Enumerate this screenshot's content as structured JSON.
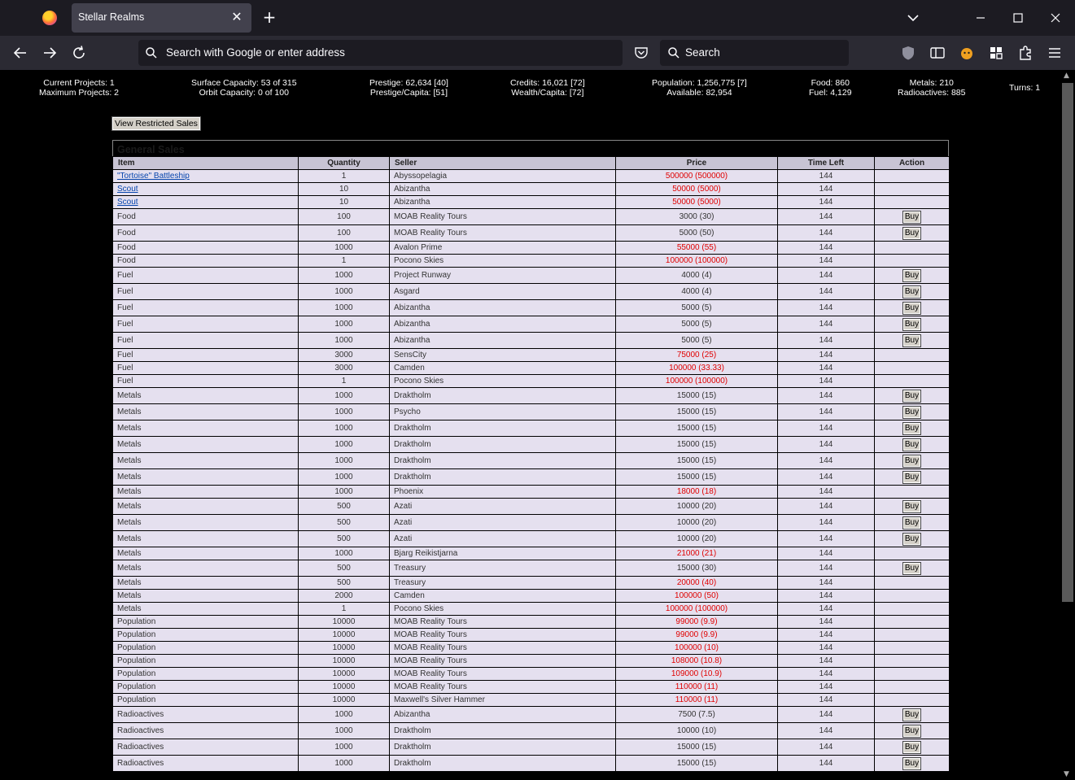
{
  "browser": {
    "tab_title": "Stellar Realms",
    "url_placeholder": "Search with Google or enter address",
    "search_placeholder": "Search"
  },
  "stats": {
    "projects_current": "Current Projects: 1",
    "projects_max": "Maximum Projects: 2",
    "surface": "Surface Capacity: 53 of 315",
    "orbit": "Orbit Capacity: 0 of 100",
    "prestige": "Prestige: 62,634 [40]",
    "prestige_capita": "Prestige/Capita: [51]",
    "credits": "Credits: 16,021 [72]",
    "wealth_capita": "Wealth/Capita: [72]",
    "population": "Population: 1,256,775 [7]",
    "available": "Available: 82,954",
    "food": "Food: 860",
    "fuel": "Fuel: 4,129",
    "metals": "Metals: 210",
    "radioactives": "Radioactives: 885",
    "turns": "Turns: 1"
  },
  "restricted_button": "View Restricted Sales",
  "sales": {
    "title": "General Sales",
    "columns": [
      "Item",
      "Quantity",
      "Seller",
      "Price",
      "Time Left",
      "Action"
    ],
    "buy_label": "Buy",
    "rows": [
      {
        "item": "\"Tortoise\" Battleship",
        "link": true,
        "qty": "1",
        "seller": "Abyssopelagia",
        "price": "500000 (500000)",
        "red": true,
        "time": "144",
        "buy": false
      },
      {
        "item": "Scout",
        "link": true,
        "qty": "10",
        "seller": "Abizantha",
        "price": "50000 (5000)",
        "red": true,
        "time": "144",
        "buy": false
      },
      {
        "item": "Scout",
        "link": true,
        "qty": "10",
        "seller": "Abizantha",
        "price": "50000 (5000)",
        "red": true,
        "time": "144",
        "buy": false
      },
      {
        "item": "Food",
        "qty": "100",
        "seller": "MOAB Reality Tours",
        "price": "3000 (30)",
        "red": false,
        "time": "144",
        "buy": true
      },
      {
        "item": "Food",
        "qty": "100",
        "seller": "MOAB Reality Tours",
        "price": "5000 (50)",
        "red": false,
        "time": "144",
        "buy": true
      },
      {
        "item": "Food",
        "qty": "1000",
        "seller": "Avalon Prime",
        "price": "55000 (55)",
        "red": true,
        "time": "144",
        "buy": false
      },
      {
        "item": "Food",
        "qty": "1",
        "seller": "Pocono Skies",
        "price": "100000 (100000)",
        "red": true,
        "time": "144",
        "buy": false
      },
      {
        "item": "Fuel",
        "qty": "1000",
        "seller": "Project Runway",
        "price": "4000 (4)",
        "red": false,
        "time": "144",
        "buy": true
      },
      {
        "item": "Fuel",
        "qty": "1000",
        "seller": "Asgard",
        "price": "4000 (4)",
        "red": false,
        "time": "144",
        "buy": true
      },
      {
        "item": "Fuel",
        "qty": "1000",
        "seller": "Abizantha",
        "price": "5000 (5)",
        "red": false,
        "time": "144",
        "buy": true
      },
      {
        "item": "Fuel",
        "qty": "1000",
        "seller": "Abizantha",
        "price": "5000 (5)",
        "red": false,
        "time": "144",
        "buy": true
      },
      {
        "item": "Fuel",
        "qty": "1000",
        "seller": "Abizantha",
        "price": "5000 (5)",
        "red": false,
        "time": "144",
        "buy": true
      },
      {
        "item": "Fuel",
        "qty": "3000",
        "seller": "SensCity",
        "price": "75000 (25)",
        "red": true,
        "time": "144",
        "buy": false
      },
      {
        "item": "Fuel",
        "qty": "3000",
        "seller": "Camden",
        "price": "100000 (33.33)",
        "red": true,
        "time": "144",
        "buy": false
      },
      {
        "item": "Fuel",
        "qty": "1",
        "seller": "Pocono Skies",
        "price": "100000 (100000)",
        "red": true,
        "time": "144",
        "buy": false
      },
      {
        "item": "Metals",
        "qty": "1000",
        "seller": "Draktholm",
        "price": "15000 (15)",
        "red": false,
        "time": "144",
        "buy": true
      },
      {
        "item": "Metals",
        "qty": "1000",
        "seller": "Psycho",
        "price": "15000 (15)",
        "red": false,
        "time": "144",
        "buy": true
      },
      {
        "item": "Metals",
        "qty": "1000",
        "seller": "Draktholm",
        "price": "15000 (15)",
        "red": false,
        "time": "144",
        "buy": true
      },
      {
        "item": "Metals",
        "qty": "1000",
        "seller": "Draktholm",
        "price": "15000 (15)",
        "red": false,
        "time": "144",
        "buy": true
      },
      {
        "item": "Metals",
        "qty": "1000",
        "seller": "Draktholm",
        "price": "15000 (15)",
        "red": false,
        "time": "144",
        "buy": true
      },
      {
        "item": "Metals",
        "qty": "1000",
        "seller": "Draktholm",
        "price": "15000 (15)",
        "red": false,
        "time": "144",
        "buy": true
      },
      {
        "item": "Metals",
        "qty": "1000",
        "seller": "Phoenix",
        "price": "18000 (18)",
        "red": true,
        "time": "144",
        "buy": false
      },
      {
        "item": "Metals",
        "qty": "500",
        "seller": "Azati",
        "price": "10000 (20)",
        "red": false,
        "time": "144",
        "buy": true
      },
      {
        "item": "Metals",
        "qty": "500",
        "seller": "Azati",
        "price": "10000 (20)",
        "red": false,
        "time": "144",
        "buy": true
      },
      {
        "item": "Metals",
        "qty": "500",
        "seller": "Azati",
        "price": "10000 (20)",
        "red": false,
        "time": "144",
        "buy": true
      },
      {
        "item": "Metals",
        "qty": "1000",
        "seller": "Bjarg Reikistjarna",
        "price": "21000 (21)",
        "red": true,
        "time": "144",
        "buy": false
      },
      {
        "item": "Metals",
        "qty": "500",
        "seller": "Treasury",
        "price": "15000 (30)",
        "red": false,
        "time": "144",
        "buy": true
      },
      {
        "item": "Metals",
        "qty": "500",
        "seller": "Treasury",
        "price": "20000 (40)",
        "red": true,
        "time": "144",
        "buy": false
      },
      {
        "item": "Metals",
        "qty": "2000",
        "seller": "Camden",
        "price": "100000 (50)",
        "red": true,
        "time": "144",
        "buy": false
      },
      {
        "item": "Metals",
        "qty": "1",
        "seller": "Pocono Skies",
        "price": "100000 (100000)",
        "red": true,
        "time": "144",
        "buy": false
      },
      {
        "item": "Population",
        "qty": "10000",
        "seller": "MOAB Reality Tours",
        "price": "99000 (9.9)",
        "red": true,
        "time": "144",
        "buy": false
      },
      {
        "item": "Population",
        "qty": "10000",
        "seller": "MOAB Reality Tours",
        "price": "99000 (9.9)",
        "red": true,
        "time": "144",
        "buy": false
      },
      {
        "item": "Population",
        "qty": "10000",
        "seller": "MOAB Reality Tours",
        "price": "100000 (10)",
        "red": true,
        "time": "144",
        "buy": false
      },
      {
        "item": "Population",
        "qty": "10000",
        "seller": "MOAB Reality Tours",
        "price": "108000 (10.8)",
        "red": true,
        "time": "144",
        "buy": false
      },
      {
        "item": "Population",
        "qty": "10000",
        "seller": "MOAB Reality Tours",
        "price": "109000 (10.9)",
        "red": true,
        "time": "144",
        "buy": false
      },
      {
        "item": "Population",
        "qty": "10000",
        "seller": "MOAB Reality Tours",
        "price": "110000 (11)",
        "red": true,
        "time": "144",
        "buy": false
      },
      {
        "item": "Population",
        "qty": "10000",
        "seller": "Maxwell's Silver Hammer",
        "price": "110000 (11)",
        "red": true,
        "time": "144",
        "buy": false
      },
      {
        "item": "Radioactives",
        "qty": "1000",
        "seller": "Abizantha",
        "price": "7500 (7.5)",
        "red": false,
        "time": "144",
        "buy": true
      },
      {
        "item": "Radioactives",
        "qty": "1000",
        "seller": "Draktholm",
        "price": "10000 (10)",
        "red": false,
        "time": "144",
        "buy": true
      },
      {
        "item": "Radioactives",
        "qty": "1000",
        "seller": "Draktholm",
        "price": "15000 (15)",
        "red": false,
        "time": "144",
        "buy": true
      },
      {
        "item": "Radioactives",
        "qty": "1000",
        "seller": "Draktholm",
        "price": "15000 (15)",
        "red": false,
        "time": "144",
        "buy": true
      }
    ]
  }
}
